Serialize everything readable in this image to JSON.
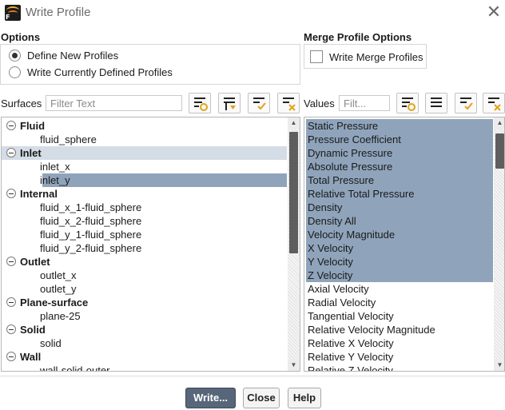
{
  "window": {
    "title": "Write Profile",
    "close_glyph": "✕",
    "app_icon": "fluent-app-icon"
  },
  "options": {
    "label": "Options",
    "radios": [
      {
        "label": "Define New Profiles",
        "checked": true
      },
      {
        "label": "Write Currently Defined Profiles",
        "checked": false
      }
    ]
  },
  "merge": {
    "label": "Merge Profile Options",
    "checkbox_label": "Write Merge Profiles",
    "checked": false
  },
  "surfaces": {
    "label": "Surfaces",
    "filter_placeholder": "Filter Text",
    "tree": [
      {
        "group": "Fluid",
        "highlight": false,
        "children": [
          {
            "label": "fluid_sphere",
            "selected": false
          }
        ]
      },
      {
        "group": "Inlet",
        "highlight": true,
        "children": [
          {
            "label": "inlet_x",
            "selected": false
          },
          {
            "label": "inlet_y",
            "selected": true
          }
        ]
      },
      {
        "group": "Internal",
        "highlight": false,
        "children": [
          {
            "label": "fluid_x_1-fluid_sphere",
            "selected": false
          },
          {
            "label": "fluid_x_2-fluid_sphere",
            "selected": false
          },
          {
            "label": "fluid_y_1-fluid_sphere",
            "selected": false
          },
          {
            "label": "fluid_y_2-fluid_sphere",
            "selected": false
          }
        ]
      },
      {
        "group": "Outlet",
        "highlight": false,
        "children": [
          {
            "label": "outlet_x",
            "selected": false
          },
          {
            "label": "outlet_y",
            "selected": false
          }
        ]
      },
      {
        "group": "Plane-surface",
        "highlight": false,
        "children": [
          {
            "label": "plane-25",
            "selected": false
          }
        ]
      },
      {
        "group": "Solid",
        "highlight": false,
        "children": [
          {
            "label": "solid",
            "selected": false
          }
        ]
      },
      {
        "group": "Wall",
        "highlight": false,
        "children": [
          {
            "label": "wall-solid-outer",
            "selected": false
          }
        ]
      }
    ]
  },
  "values": {
    "label": "Values",
    "filter_placeholder": "Filt...",
    "items": [
      {
        "label": "Static Pressure",
        "selected": true
      },
      {
        "label": "Pressure Coefficient",
        "selected": true
      },
      {
        "label": "Dynamic Pressure",
        "selected": true
      },
      {
        "label": "Absolute Pressure",
        "selected": true
      },
      {
        "label": "Total Pressure",
        "selected": true
      },
      {
        "label": "Relative Total Pressure",
        "selected": true
      },
      {
        "label": "Density",
        "selected": true
      },
      {
        "label": "Density All",
        "selected": true
      },
      {
        "label": "Velocity Magnitude",
        "selected": true
      },
      {
        "label": "X Velocity",
        "selected": true
      },
      {
        "label": "Y Velocity",
        "selected": true
      },
      {
        "label": "Z Velocity",
        "selected": true
      },
      {
        "label": "Axial Velocity",
        "selected": false
      },
      {
        "label": "Radial Velocity",
        "selected": false
      },
      {
        "label": "Tangential Velocity",
        "selected": false
      },
      {
        "label": "Relative Velocity Magnitude",
        "selected": false
      },
      {
        "label": "Relative X Velocity",
        "selected": false
      },
      {
        "label": "Relative Y Velocity",
        "selected": false
      },
      {
        "label": "Relative Z Velocity",
        "selected": false
      }
    ]
  },
  "toolbar_icons": {
    "surfaces": [
      "select-all-icon",
      "deselect-all-icon",
      "check-list-icon",
      "clear-list-icon"
    ],
    "values": [
      "select-all-icon",
      "deselect-all-icon",
      "check-list-icon",
      "clear-list-icon"
    ]
  },
  "buttons": {
    "write": "Write...",
    "close": "Close",
    "help": "Help"
  },
  "colors": {
    "selection": "#8fa4bb",
    "group_highlight": "#d4dce6",
    "primary_button": "#58667a",
    "icon_accent": "#e3a21a"
  }
}
